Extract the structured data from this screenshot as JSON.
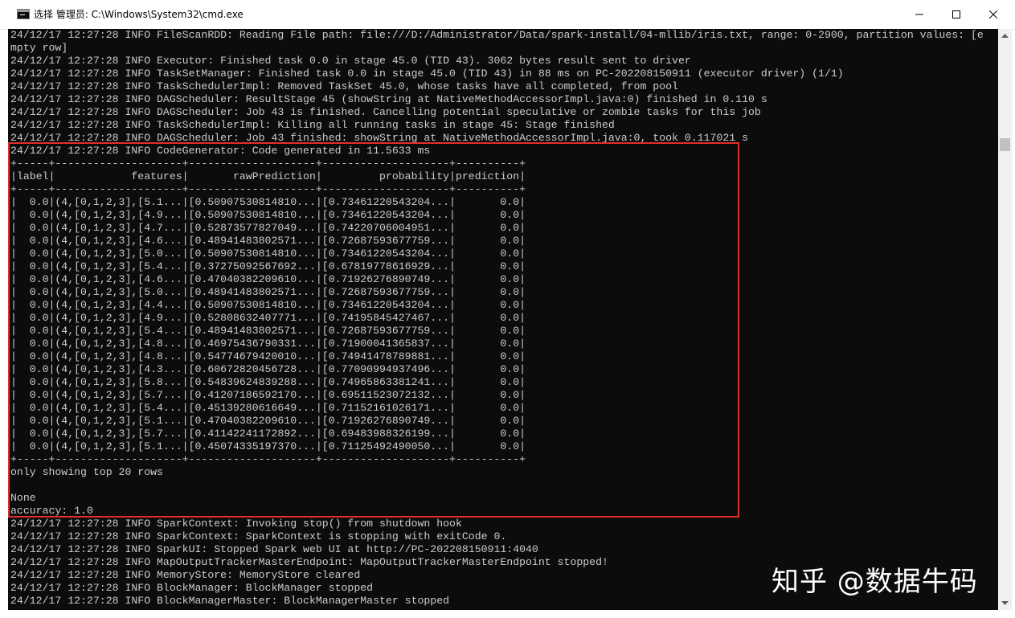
{
  "window": {
    "title": "选择 管理员: C:\\Windows\\System32\\cmd.exe",
    "icon": "cmd-icon",
    "buttons": {
      "minimize": "minimize-icon",
      "maximize": "maximize-icon",
      "close": "close-icon"
    }
  },
  "console": {
    "background": "#0c0c0c",
    "foreground": "#cccccc",
    "lines": [
      "24/12/17 12:27:28 INFO FileScanRDD: Reading File path: file:///D:/Administrator/Data/spark-install/04-mllib/iris.txt, range: 0-2900, partition values: [e",
      "mpty row]",
      "24/12/17 12:27:28 INFO Executor: Finished task 0.0 in stage 45.0 (TID 43). 3062 bytes result sent to driver",
      "24/12/17 12:27:28 INFO TaskSetManager: Finished task 0.0 in stage 45.0 (TID 43) in 88 ms on PC-202208150911 (executor driver) (1/1)",
      "24/12/17 12:27:28 INFO TaskSchedulerImpl: Removed TaskSet 45.0, whose tasks have all completed, from pool",
      "24/12/17 12:27:28 INFO DAGScheduler: ResultStage 45 (showString at NativeMethodAccessorImpl.java:0) finished in 0.110 s",
      "24/12/17 12:27:28 INFO DAGScheduler: Job 43 is finished. Cancelling potential speculative or zombie tasks for this job",
      "24/12/17 12:27:28 INFO TaskSchedulerImpl: Killing all running tasks in stage 45: Stage finished",
      "24/12/17 12:27:28 INFO DAGScheduler: Job 43 finished: showString at NativeMethodAccessorImpl.java:0, took 0.117021 s",
      "24/12/17 12:27:28 INFO CodeGenerator: Code generated in 11.5633 ms",
      "+-----+--------------------+--------------------+--------------------+----------+",
      "|label|            features|       rawPrediction|         probability|prediction|",
      "+-----+--------------------+--------------------+--------------------+----------+",
      "|  0.0|(4,[0,1,2,3],[5.1...|[0.50907530814810...|[0.73461220543204...|       0.0|",
      "|  0.0|(4,[0,1,2,3],[4.9...|[0.50907530814810...|[0.73461220543204...|       0.0|",
      "|  0.0|(4,[0,1,2,3],[4.7...|[0.52873577827049...|[0.74220706004951...|       0.0|",
      "|  0.0|(4,[0,1,2,3],[4.6...|[0.48941483802571...|[0.72687593677759...|       0.0|",
      "|  0.0|(4,[0,1,2,3],[5.0...|[0.50907530814810...|[0.73461220543204...|       0.0|",
      "|  0.0|(4,[0,1,2,3],[5.4...|[0.37275092567692...|[0.67819778616929...|       0.0|",
      "|  0.0|(4,[0,1,2,3],[4.6...|[0.47040382209610...|[0.71926276890749...|       0.0|",
      "|  0.0|(4,[0,1,2,3],[5.0...|[0.48941483802571...|[0.72687593677759...|       0.0|",
      "|  0.0|(4,[0,1,2,3],[4.4...|[0.50907530814810...|[0.73461220543204...|       0.0|",
      "|  0.0|(4,[0,1,2,3],[4.9...|[0.52808632407771...|[0.74195845427467...|       0.0|",
      "|  0.0|(4,[0,1,2,3],[5.4...|[0.48941483802571...|[0.72687593677759...|       0.0|",
      "|  0.0|(4,[0,1,2,3],[4.8...|[0.46975436790331...|[0.71900041365837...|       0.0|",
      "|  0.0|(4,[0,1,2,3],[4.8...|[0.54774679420010...|[0.74941478789881...|       0.0|",
      "|  0.0|(4,[0,1,2,3],[4.3...|[0.60672820456728...|[0.77090994937496...|       0.0|",
      "|  0.0|(4,[0,1,2,3],[5.8...|[0.54839624839288...|[0.74965863381241...|       0.0|",
      "|  0.0|(4,[0,1,2,3],[5.7...|[0.41207186592170...|[0.69511523072132...|       0.0|",
      "|  0.0|(4,[0,1,2,3],[5.4...|[0.45139280616649...|[0.71152161026171...|       0.0|",
      "|  0.0|(4,[0,1,2,3],[5.1...|[0.47040382209610...|[0.71926276890749...|       0.0|",
      "|  0.0|(4,[0,1,2,3],[5.7...|[0.41142241172892...|[0.69483988326199...|       0.0|",
      "|  0.0|(4,[0,1,2,3],[5.1...|[0.45074335197370...|[0.71125492490050...|       0.0|",
      "+-----+--------------------+--------------------+--------------------+----------+",
      "only showing top 20 rows",
      "",
      "None",
      "accuracy: 1.0",
      "24/12/17 12:27:28 INFO SparkContext: Invoking stop() from shutdown hook",
      "24/12/17 12:27:28 INFO SparkContext: SparkContext is stopping with exitCode 0.",
      "24/12/17 12:27:28 INFO SparkUI: Stopped Spark web UI at http://PC-202208150911:4040",
      "24/12/17 12:27:28 INFO MapOutputTrackerMasterEndpoint: MapOutputTrackerMasterEndpoint stopped!",
      "24/12/17 12:27:28 INFO MemoryStore: MemoryStore cleared",
      "24/12/17 12:27:28 INFO BlockManager: BlockManager stopped",
      "24/12/17 12:27:28 INFO BlockManagerMaster: BlockManagerMaster stopped"
    ]
  },
  "highlight": {
    "color": "#e0302c"
  },
  "watermark": {
    "text": "知乎 @数据牛码"
  },
  "scrollbar": {
    "up": "scroll-up-arrow-icon",
    "down": "scroll-down-arrow-icon"
  }
}
